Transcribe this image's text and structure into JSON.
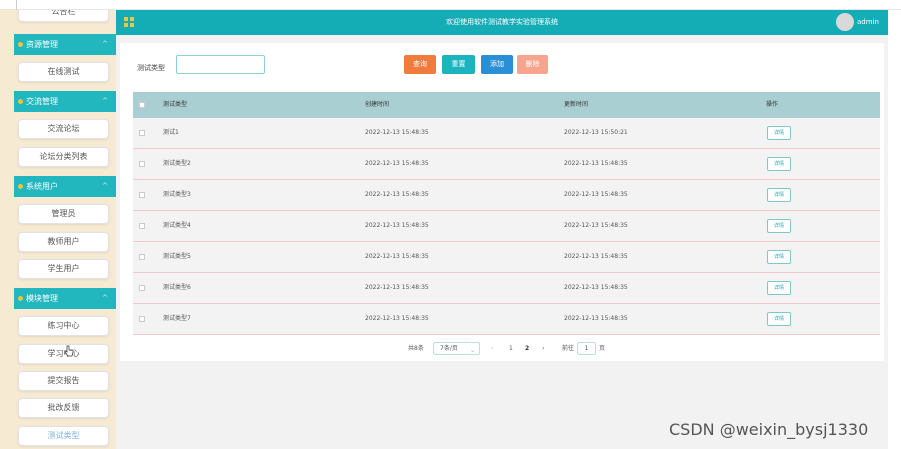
{
  "header": {
    "title": "欢迎使用软件测试教学实验管理系统",
    "user": "admin"
  },
  "sidebar": {
    "top_item": "公告栏",
    "groups": [
      {
        "label": "资源管理",
        "items": [
          "在线测试"
        ]
      },
      {
        "label": "交流管理",
        "items": [
          "交流论坛",
          "论坛分类列表"
        ]
      },
      {
        "label": "系统用户",
        "items": [
          "管理员",
          "教师用户",
          "学生用户"
        ]
      },
      {
        "label": "模块管理",
        "items": [
          "练习中心",
          "学习中心",
          "提交报告",
          "批改反馈",
          "测试类型"
        ]
      }
    ]
  },
  "search": {
    "label": "测试类型",
    "value": "",
    "placeholder": ""
  },
  "buttons": {
    "query": "查询",
    "reset": "重置",
    "add": "添加",
    "delete": "删除"
  },
  "table": {
    "headers": {
      "type": "测试类型",
      "created": "创建时间",
      "updated": "更新时间",
      "op": "操作"
    },
    "rows": [
      {
        "type": "测试1",
        "created": "2022-12-13 15:48:35",
        "updated": "2022-12-13 15:50:21",
        "op": "详情"
      },
      {
        "type": "测试类型2",
        "created": "2022-12-13 15:48:35",
        "updated": "2022-12-13 15:48:35",
        "op": "详情"
      },
      {
        "type": "测试类型3",
        "created": "2022-12-13 15:48:35",
        "updated": "2022-12-13 15:48:35",
        "op": "详情"
      },
      {
        "type": "测试类型4",
        "created": "2022-12-13 15:48:35",
        "updated": "2022-12-13 15:48:35",
        "op": "详情"
      },
      {
        "type": "测试类型5",
        "created": "2022-12-13 15:48:35",
        "updated": "2022-12-13 15:48:35",
        "op": "详情"
      },
      {
        "type": "测试类型6",
        "created": "2022-12-13 15:48:35",
        "updated": "2022-12-13 15:48:35",
        "op": "详情"
      },
      {
        "type": "测试类型7",
        "created": "2022-12-13 15:48:35",
        "updated": "2022-12-13 15:48:35",
        "op": "详情"
      }
    ]
  },
  "pagination": {
    "total": "共8条",
    "page_size": "7条/页",
    "prev": "‹",
    "pages": [
      "1",
      "2"
    ],
    "next": "›",
    "goto_label": "前往",
    "goto_value": "1",
    "page_suffix": "页"
  },
  "watermark": "CSDN @weixin_bysj1330",
  "colors": {
    "header": "#14adb6",
    "sidebar_bg": "#f6ead3",
    "query": "#ef7b3d",
    "reset": "#1cb5bf",
    "add": "#2b8fd6",
    "delete": "#f6a48e"
  }
}
